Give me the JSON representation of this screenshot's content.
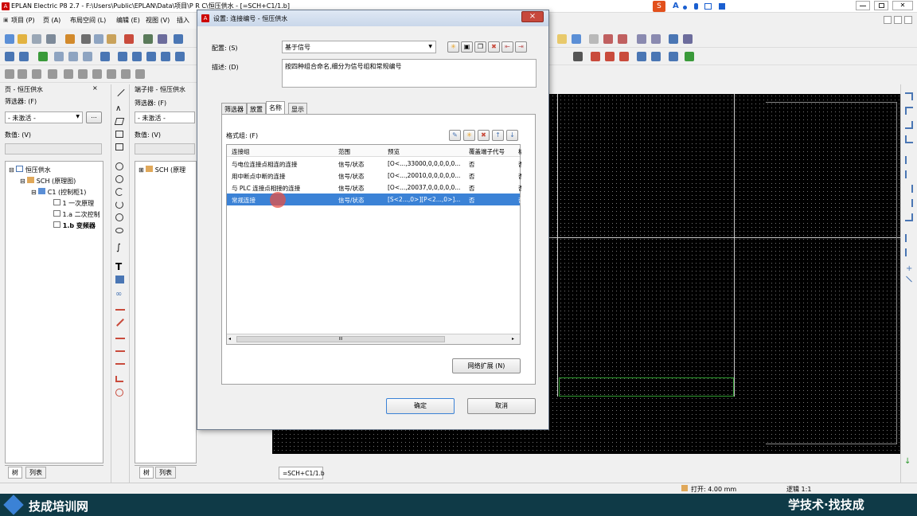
{
  "app": {
    "title": "EPLAN Electric P8 2.7 - F:\\Users\\Public\\EPLAN\\Data\\项目\\P R C\\恒压供水 - [=SCH+C1/1.b]"
  },
  "menu": [
    "项目 (P)",
    "页 (A)",
    "布局空间 (L)",
    "编辑 (E)",
    "视图 (V)",
    "插入"
  ],
  "tray": {
    "text": "A"
  },
  "left_panel": {
    "title": "页 - 恒压供水",
    "filter_label": "筛选器: (F)",
    "filter_value": "- 未激活 -",
    "more_button": "...",
    "value_label": "数值: (V)",
    "tree": [
      {
        "text": "恒压供水"
      },
      {
        "text": "SCH (原理图)"
      },
      {
        "text": "C1 (控制柜1)"
      },
      {
        "text": "1 一次原理"
      },
      {
        "text": "1.a 二次控制"
      },
      {
        "text": "1.b 变频器"
      }
    ],
    "tabs": [
      "树",
      "列表"
    ]
  },
  "mid_panel": {
    "title": "端子排 - 恒压供水",
    "filter_label": "筛选器: (F)",
    "filter_value": "- 未激活 -",
    "value_label": "数值: (V)",
    "tree_item": "SCH (原理",
    "tabs": [
      "树",
      "列表"
    ]
  },
  "canvas": {
    "tab_label": "=SCH+C1/1.b"
  },
  "dialog": {
    "title": "设置: 连接编号 - 恒压供水",
    "close": "×",
    "config_label": "配置: (S)",
    "config_value": "基于信号",
    "desc_label": "描述: (D)",
    "desc_value": "按四种组合命名,细分为信号组和常规编号",
    "tabs": [
      "筛选器",
      "放置",
      "名称",
      "显示"
    ],
    "format_group_label": "格式组: (F)",
    "columns": [
      "连接组",
      "范围",
      "预览",
      "覆盖端子代号",
      "格"
    ],
    "rows": [
      {
        "group": "与电位连接点相连的连接",
        "range": "信号/状态",
        "preview": "[O<...,33000,0,0,0,0,0...",
        "override": "否",
        "extra": "否"
      },
      {
        "group": "用中断点中断的连接",
        "range": "信号/状态",
        "preview": "[O<...,20010,0,0,0,0,0...",
        "override": "否",
        "extra": "否"
      },
      {
        "group": "与 PLC 连接点相接的连接",
        "range": "信号/状态",
        "preview": "[O<...,20037,0,0,0,0,0...",
        "override": "否",
        "extra": "否"
      },
      {
        "group": "常规连接",
        "range": "信号/状态",
        "preview": "[S<2...,0>][P<2...,0>]...",
        "override": "否",
        "extra": "否"
      }
    ],
    "scroll_mark": "III",
    "network_button": "网络扩展 (N)",
    "ok_button": "确定",
    "cancel_button": "取消"
  },
  "status": {
    "open": "打开: 4.00 mm",
    "logic": "逻辑 1:1"
  },
  "footer": {
    "brand": "技成培训网",
    "slogan": "学技术·找技成"
  },
  "colors": {
    "accent": "#3b82d6",
    "footer": "#0f3a47",
    "close": "#c7483c"
  }
}
